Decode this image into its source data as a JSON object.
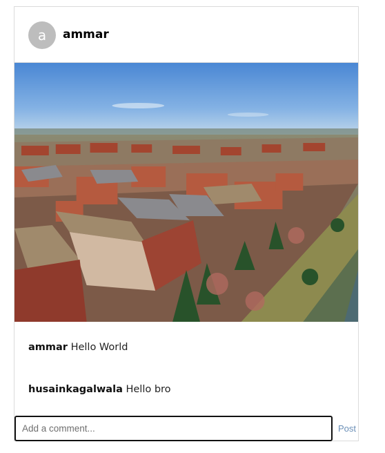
{
  "post": {
    "avatar_letter": "a",
    "username": "ammar",
    "image_alt": "aerial-suburban-townhouses-photo"
  },
  "comments": [
    {
      "user": "ammar",
      "text": "Hello World"
    },
    {
      "user": "husainkagalwala",
      "text": "Hello bro"
    }
  ],
  "comment_input": {
    "placeholder": "Add a comment...",
    "value": ""
  },
  "post_button": {
    "label": "Post"
  },
  "colors": {
    "avatar_bg": "#bdbdbd",
    "border": "#dbdbdb",
    "post_button": "#6b8fb7",
    "sky": "#5f93d6"
  }
}
